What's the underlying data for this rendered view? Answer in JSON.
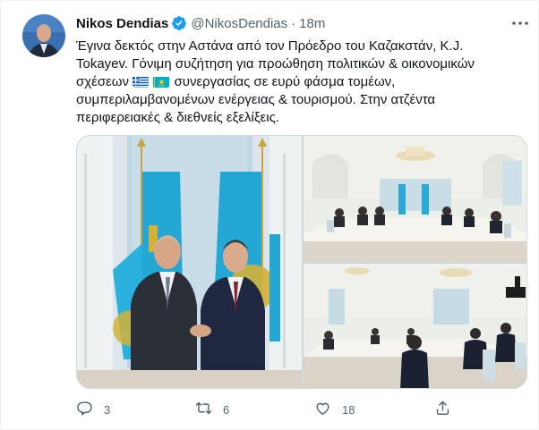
{
  "author": {
    "name": "Nikos Dendias",
    "handle": "@NikosDendias",
    "separator": "·",
    "time": "18m",
    "verified": true
  },
  "tweet": {
    "lines": [
      "Έγινα δεκτός στην Αστάνα από τον Πρόεδρο του Καζακστάν, K.J.",
      "Tokayev. Γόνιμη συζήτηση για προώθηση πολιτικών & οικονομικών",
      "συνεργασίας σε ευρύ φάσμα τομέων,",
      "συμπεριλαμβανομένων ενέργειας & τουρισμού. Στην ατζέντα",
      "περιφερειακές & διεθνείς εξελίξεις."
    ],
    "line3_prefix": "σχέσεων",
    "flags": [
      "greece-flag",
      "kazakhstan-flag"
    ]
  },
  "media": {
    "photos": [
      "handshake-photo",
      "meeting-room-photo",
      "meeting-room-photo-2"
    ]
  },
  "actions": {
    "reply_count": "3",
    "retweet_count": "6",
    "like_count": "18",
    "share_count": ""
  },
  "colors": {
    "text": "#0f1419",
    "secondary": "#536471",
    "verified": "#1d9bf0",
    "border": "#cfd9de"
  },
  "icons": [
    "verified-badge-icon",
    "more-icon",
    "reply-icon",
    "retweet-icon",
    "like-icon",
    "share-icon"
  ]
}
